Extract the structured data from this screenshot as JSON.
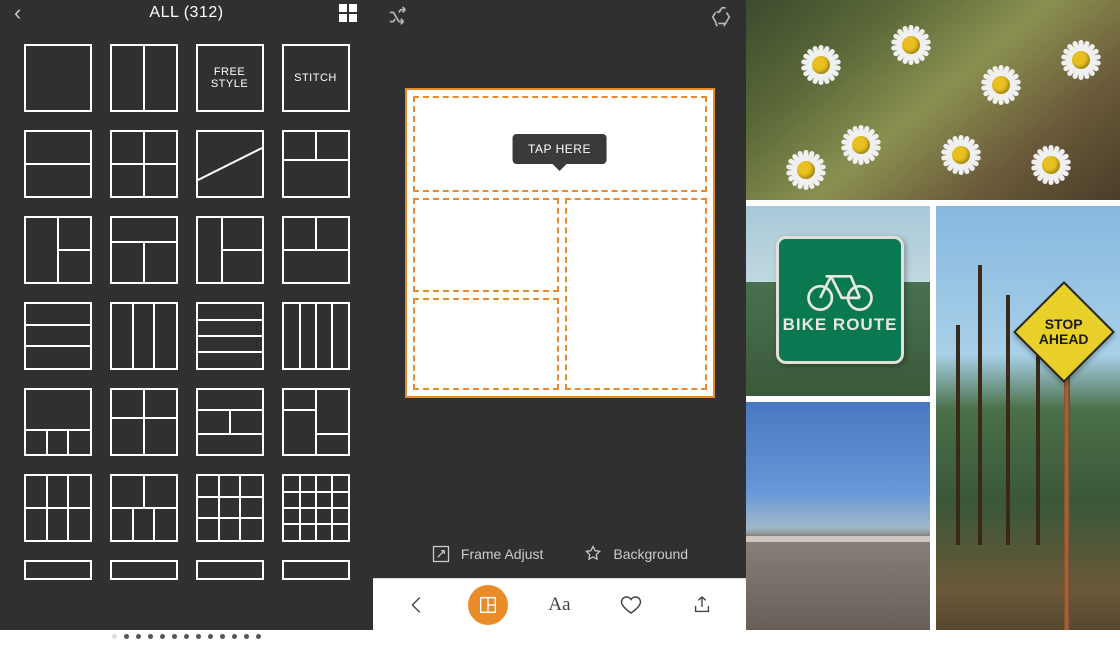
{
  "panel1": {
    "title": "ALL (312)",
    "special_layouts": {
      "freestyle": "FREE\nSTYLE",
      "stitch": "STITCH"
    },
    "page_dots": {
      "count": 13,
      "active": 0
    }
  },
  "panel2": {
    "tooltip": "TAP HERE",
    "opt_frame": "Frame Adjust",
    "opt_bg": "Background",
    "tab_type": "Aa"
  },
  "panel3": {
    "bike_sign": "BIKE ROUTE",
    "stop_sign": "STOP\nAHEAD"
  }
}
